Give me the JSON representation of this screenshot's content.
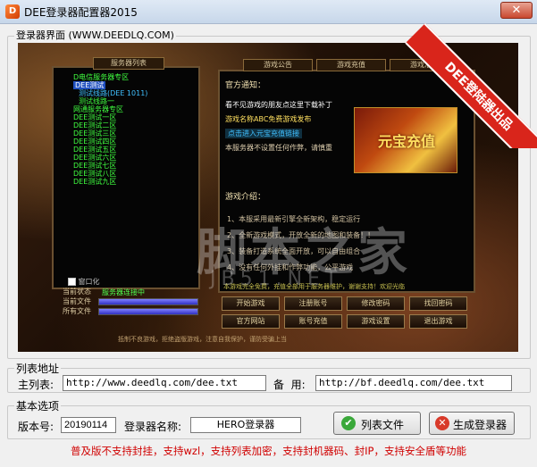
{
  "window": {
    "title": "DEE登录器配置器2015",
    "close_symbol": "✕",
    "app_icon_char": "D"
  },
  "preview_group": {
    "title": "登录器界面 (WWW.DEEDLQ.COM)",
    "ribbon": "DEE登陆器出品",
    "watermark": "脚本之家",
    "watermark_sub": "JB51.NET",
    "server_tab": "服务器列表",
    "tree": [
      {
        "text": "D电信服务器专区",
        "color": "#40ff40"
      },
      {
        "text": "DEE测试",
        "color": "#ffffff",
        "selected": true
      },
      {
        "text": "测试线路(DEE 1011)",
        "color": "#40c0ff"
      },
      {
        "text": "测试线路一",
        "color": "#40ff40"
      },
      {
        "text": "网通服务器专区",
        "color": "#40ff40"
      },
      {
        "text": "DEE测试一区",
        "color": "#40ff40"
      },
      {
        "text": "DEE测试二区",
        "color": "#40ff40"
      },
      {
        "text": "DEE测试三区",
        "color": "#40ff40"
      },
      {
        "text": "DEE测试四区",
        "color": "#40ff40"
      },
      {
        "text": "DEE测试五区",
        "color": "#40ff40"
      },
      {
        "text": "DEE测试六区",
        "color": "#40ff40"
      },
      {
        "text": "DEE测试七区",
        "color": "#40ff40"
      },
      {
        "text": "DEE测试八区",
        "color": "#40ff40"
      },
      {
        "text": "DEE测试九区",
        "color": "#40ff40"
      }
    ],
    "right_tabs": [
      "游戏公告",
      "游戏充值",
      "游戏活动"
    ],
    "notice_title": "官方通知：",
    "notice_lines": [
      {
        "text": "看不见游戏的朋友点这里下载补丁",
        "color": "#ffffff"
      },
      {
        "text": "游戏名称ABC免费游戏发布",
        "color": "#ffe060"
      },
      {
        "text": "点击进入元宝充值链接",
        "color": "#40c0ff"
      },
      {
        "text": "本服务器不设置任何作弊，请慎重",
        "color": "#e0d0b0"
      }
    ],
    "yuanbao": "元宝充值",
    "intro_title": "游戏介绍：",
    "intro_lines": [
      "1、本服采用最新引擎全新架构，稳定运行",
      "2、全新游戏模式，开放全新的地图和装备！！",
      "3、装备打造系统全面开放，可以自由组合",
      "4、没有任何外挂和作弊功能，公平游戏"
    ],
    "scroll_text": "本游戏完全免费，充值全部用于服务器维护，谢谢支持！欢迎光临",
    "checkbox_label": "窗口化",
    "status_labels": [
      "当前状态",
      "当前文件",
      "所有文件"
    ],
    "status_value": "服务器连接中",
    "game_buttons": [
      "开始游戏",
      "注册账号",
      "修改密码",
      "找回密码",
      "官方网站",
      "账号充值",
      "游戏设置",
      "退出游戏"
    ],
    "bottom_text": "抵制不良游戏，拒绝盗版游戏，注意自我保护，谨防受骗上当"
  },
  "list_group": {
    "title": "列表地址",
    "main_label": "主列表:",
    "main_value": "http://www.deedlq.com/dee.txt",
    "backup_label": "备  用:",
    "backup_value": "http://bf.deedlq.com/dee.txt"
  },
  "basic_group": {
    "title": "基本选项",
    "version_label": "版本号:",
    "version_value": "20190114",
    "name_label": "登录器名称:",
    "name_value": "HERO登录器",
    "list_file_button": "列表文件",
    "generate_button": "生成登录器"
  },
  "notice": "普及版不支持封挂，支持wzl，支持列表加密，支持封机器码、封IP，支持安全盾等功能"
}
